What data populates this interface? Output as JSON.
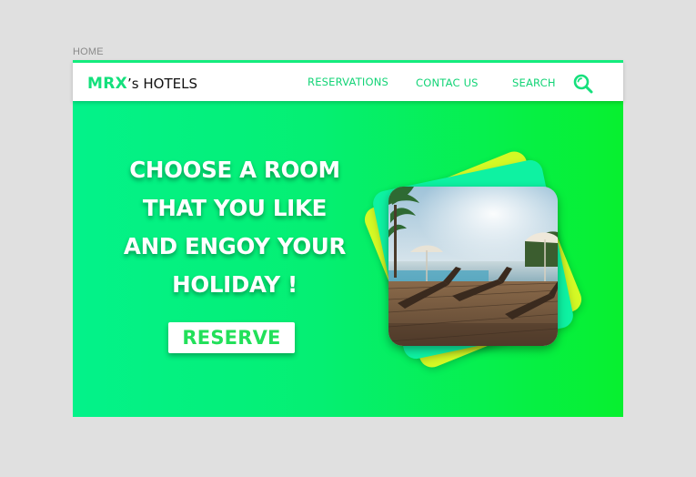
{
  "breadcrumb": {
    "label": "HOME"
  },
  "header": {
    "logo": {
      "brand": "MRX",
      "suffix": "’s HOTELS"
    },
    "nav": {
      "reservations": "RESERVATIONS",
      "contact": "CONTAC US",
      "search": "SEARCH"
    },
    "icons": {
      "search": "search-icon"
    }
  },
  "hero": {
    "headline_lines": [
      "CHOOSE A ROOM",
      "THAT YOU LIKE",
      "AND ENGOY YOUR",
      "HOLIDAY !"
    ],
    "cta_label": "RESERVE",
    "image": "pool-deck-sunloungers-photo"
  },
  "colors": {
    "accent": "#14e07c",
    "hero_gradient_start": "#03f28a",
    "hero_gradient_end": "#07f02f",
    "card_yellow": "#d4f925",
    "card_mint": "#0ef2a2",
    "page_background": "#e0e0e0"
  }
}
